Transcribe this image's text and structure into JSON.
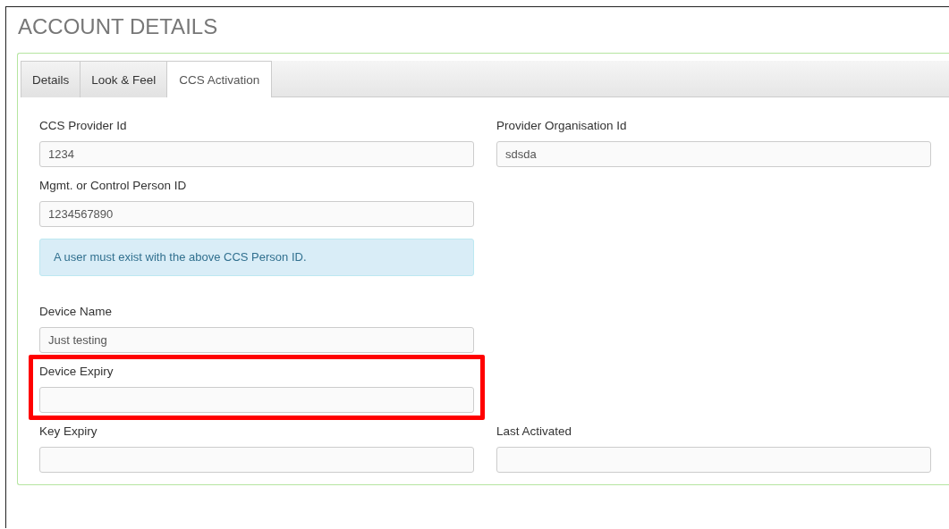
{
  "page": {
    "title": "ACCOUNT DETAILS"
  },
  "tabs": [
    {
      "label": "Details",
      "selected": false
    },
    {
      "label": "Look & Feel",
      "selected": false
    },
    {
      "label": "CCS Activation",
      "selected": true
    }
  ],
  "rows": [
    {
      "kind": "fields",
      "cells": [
        {
          "label": "CCS Provider Id",
          "value": "1234"
        },
        {
          "label": "Provider Organisation Id",
          "value": "sdsda"
        }
      ]
    },
    {
      "kind": "fields",
      "cells": [
        {
          "label": "Mgmt. or Control Person ID",
          "value": "1234567890"
        }
      ]
    },
    {
      "kind": "alert",
      "text": "A user must exist with the above CCS Person ID."
    },
    {
      "kind": "fields",
      "cells": [
        {
          "label": "Device Name",
          "value": "Just testing"
        }
      ]
    },
    {
      "kind": "fields",
      "highlighted": true,
      "cells": [
        {
          "label": "Device Expiry"
        }
      ]
    },
    {
      "kind": "fields",
      "cells": [
        {
          "label": "Key Expiry"
        },
        {
          "label": "Last Activated"
        }
      ]
    }
  ]
}
